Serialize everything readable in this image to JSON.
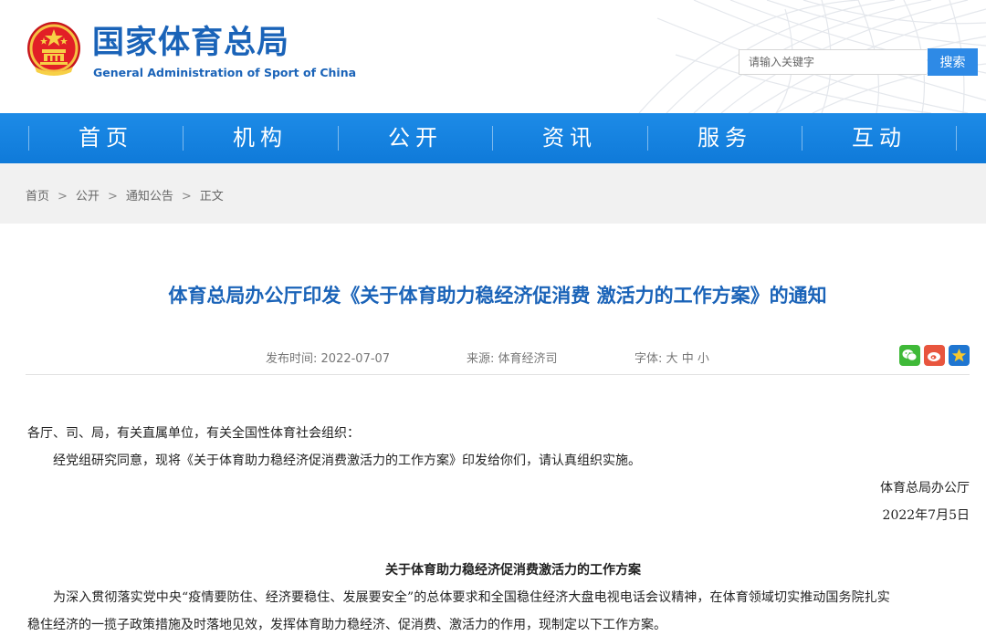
{
  "site": {
    "name_cn": "国家体育总局",
    "name_en": "General Administration of Sport of China"
  },
  "search": {
    "placeholder": "请输入关键字",
    "button": "搜索"
  },
  "nav": {
    "items": [
      {
        "label": "首页"
      },
      {
        "label": "机构"
      },
      {
        "label": "公开"
      },
      {
        "label": "资讯"
      },
      {
        "label": "服务"
      },
      {
        "label": "互动"
      }
    ]
  },
  "breadcrumb": {
    "items": [
      "首页",
      "公开",
      "通知公告",
      "正文"
    ],
    "separator": ">"
  },
  "article": {
    "title": "体育总局办公厅印发《关于体育助力稳经济促消费 激活力的工作方案》的通知",
    "date_label": "发布时间:",
    "date": "2022-07-07",
    "source_label": "来源:",
    "source": "体育经济司",
    "font_label": "字体:",
    "font_sizes": [
      "大",
      "中",
      "小"
    ],
    "share_icons": [
      "wechat-icon",
      "weibo-icon",
      "favorite-star-icon"
    ],
    "salutation": "各厅、司、局，有关直属单位，有关全国性体育社会组织：",
    "intro": "经党组研究同意，现将《关于体育助力稳经济促消费激活力的工作方案》印发给你们，请认真组织实施。",
    "signature": "体育总局办公厅",
    "sign_date": "2022年7月5日",
    "subtitle": "关于体育助力稳经济促消费激活力的工作方案",
    "para1_line1": "为深入贯彻落实党中央“疫情要防住、经济要稳住、发展要安全”的总体要求和全国稳住经济大盘电视电话会议精神，在体育领域切实推动国务院扎实",
    "para1_line2": "稳住经济的一揽子政策措施及时落地见效，发挥体育助力稳经济、促消费、激活力的作用，现制定以下工作方案。"
  },
  "colors": {
    "brand_blue": "#1a63b8",
    "nav_blue": "#1483e0",
    "search_button": "#2e8ae6"
  }
}
